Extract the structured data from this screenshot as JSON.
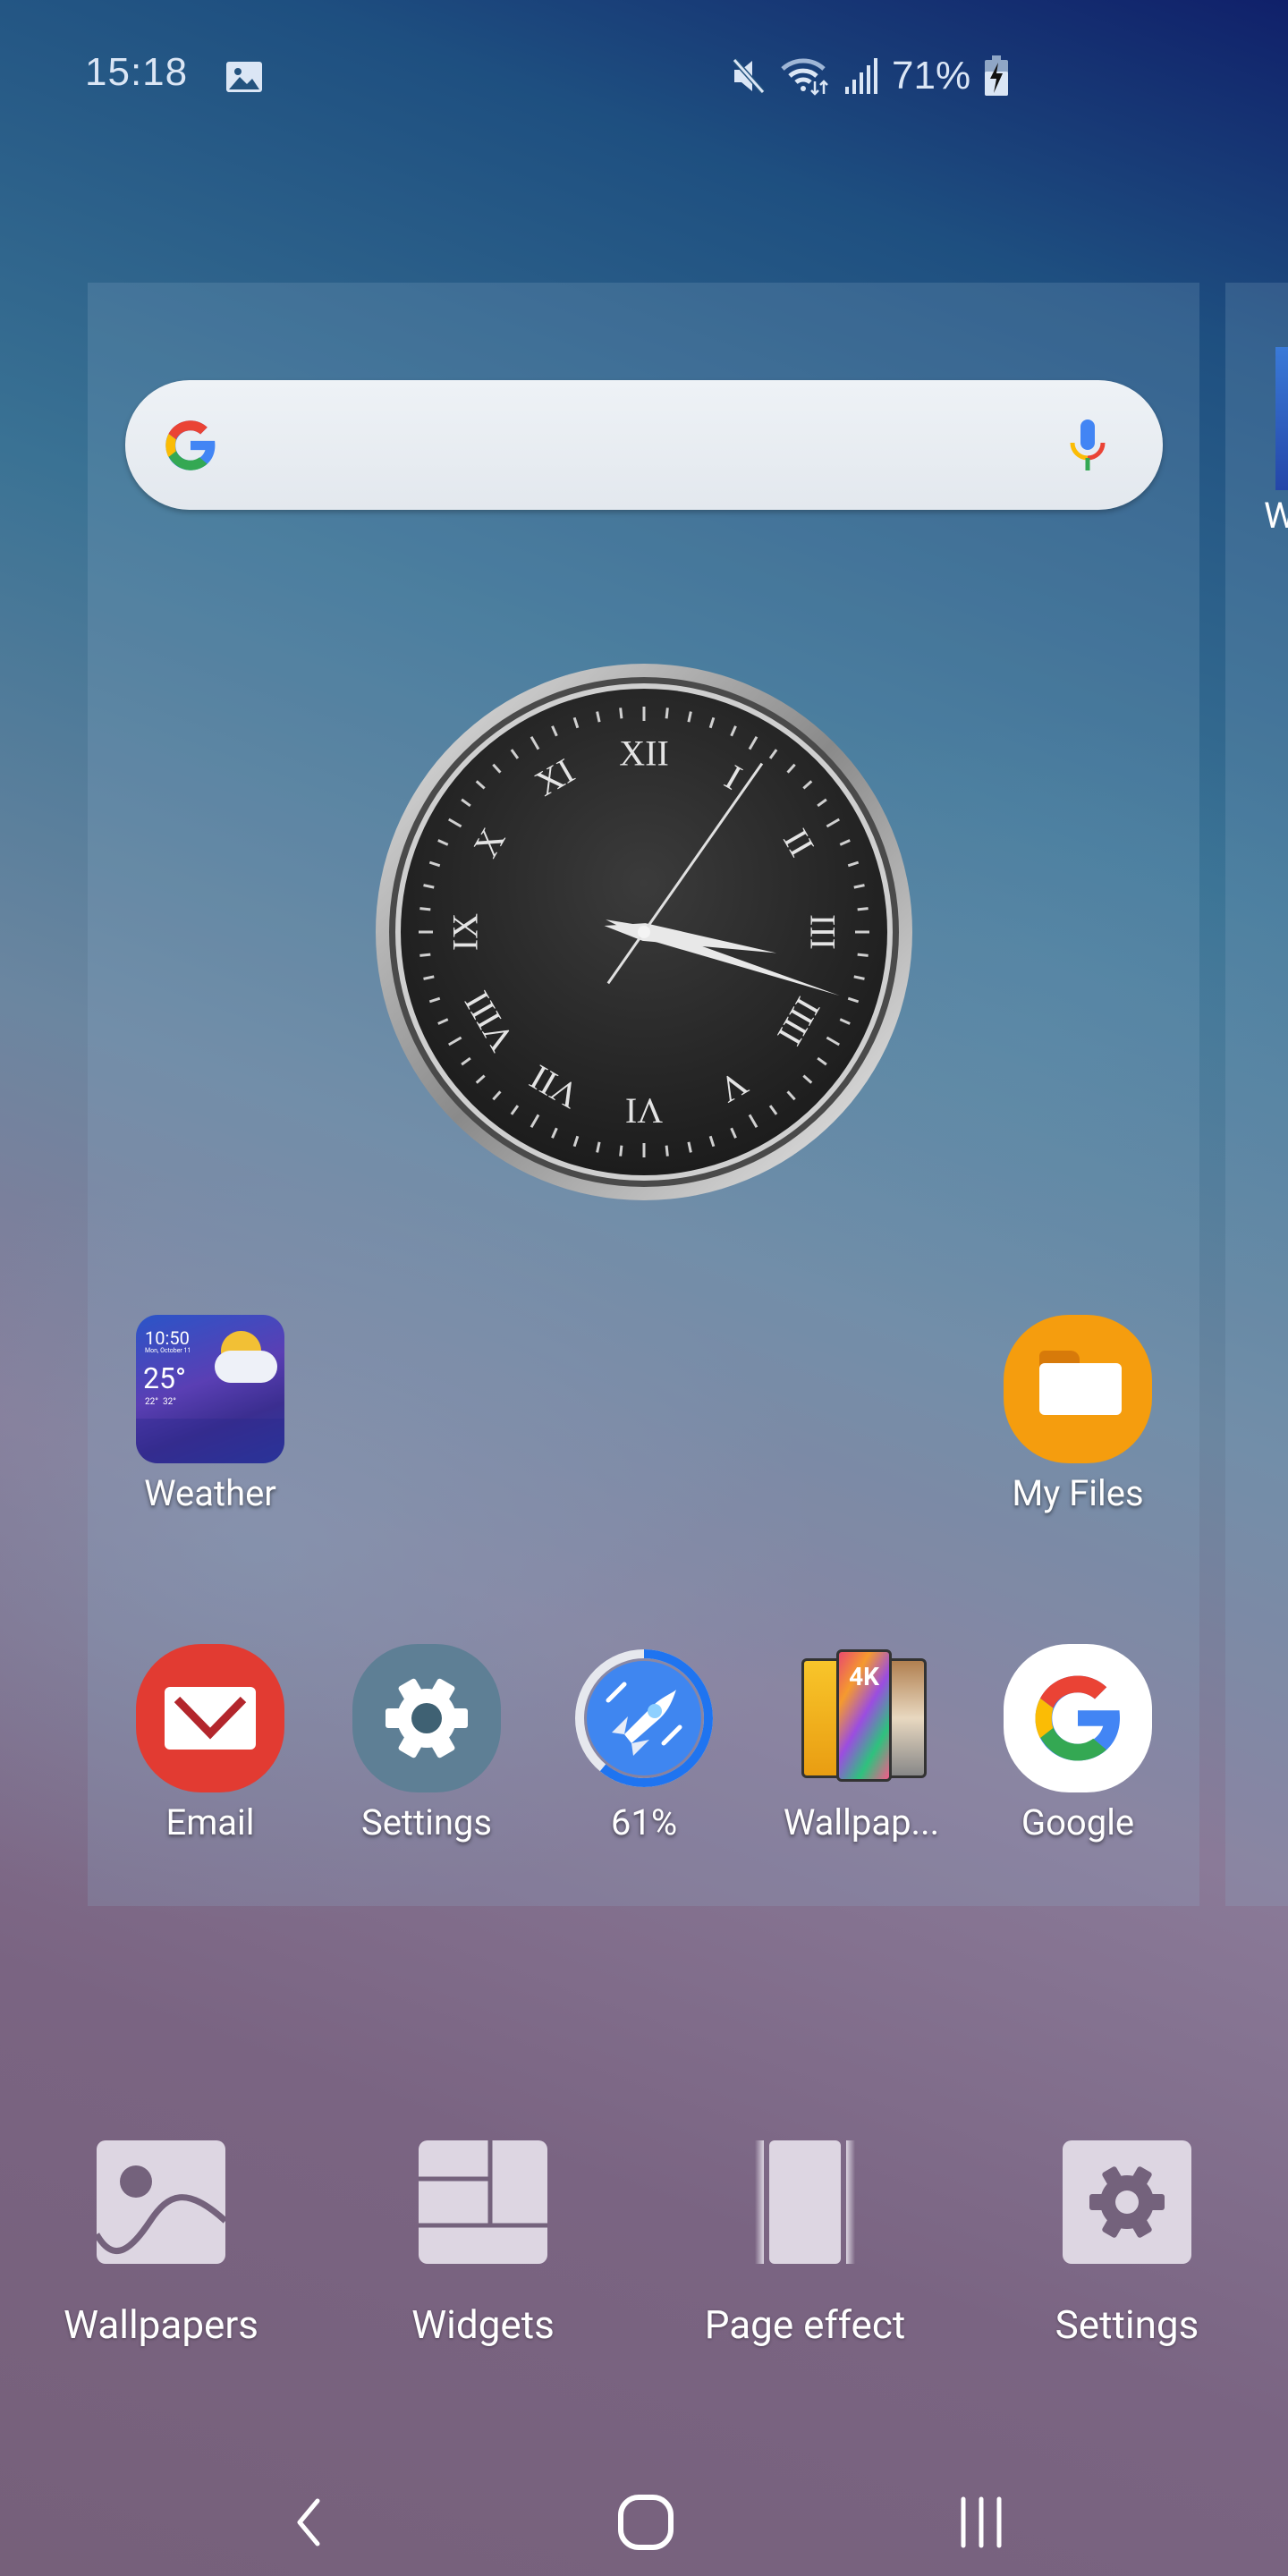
{
  "status_bar": {
    "time": "15:18",
    "notification_icons": [
      "image-icon"
    ],
    "system_icons": [
      "mute-icon",
      "wifi-icon",
      "signal-icon",
      "battery-charging-icon"
    ],
    "battery_percent": "71%"
  },
  "search_widget": {
    "logo": "google-g-icon",
    "voice_icon": "mic-icon",
    "colors": {
      "blue": "#4285F4",
      "red": "#EA4335",
      "yellow": "#FBBC05",
      "green": "#34A853"
    }
  },
  "clock_widget": {
    "type": "analog",
    "numerals": [
      "XII",
      "I",
      "II",
      "III",
      "IIII",
      "V",
      "VI",
      "VII",
      "VIII",
      "IX",
      "X",
      "XI"
    ],
    "time_shown": "15:18"
  },
  "home_apps": [
    {
      "label": "Weather",
      "icon": "weather-widget-icon",
      "preview": {
        "time": "10:50",
        "date": "Mon, October 11",
        "temp": "25°",
        "low": "22°",
        "high": "32°"
      }
    },
    {
      "label": "My Files",
      "icon": "folder-icon"
    }
  ],
  "dock_apps": [
    {
      "label": "Email",
      "icon": "email-icon"
    },
    {
      "label": "Settings",
      "icon": "gear-icon"
    },
    {
      "label": "61%",
      "icon": "rocket-booster-icon",
      "progress": 0.61
    },
    {
      "label": "Wallpap...",
      "icon": "wallpapers-4k-icon",
      "badge": "4K"
    },
    {
      "label": "Google",
      "icon": "google-icon"
    }
  ],
  "next_page": {
    "label_fragment": "W"
  },
  "edit_options": [
    {
      "label": "Wallpapers",
      "icon": "wallpaper-icon"
    },
    {
      "label": "Widgets",
      "icon": "widgets-icon"
    },
    {
      "label": "Page effect",
      "icon": "page-effect-icon"
    },
    {
      "label": "Settings",
      "icon": "settings-icon"
    }
  ],
  "nav_bar": {
    "back": "back-icon",
    "home": "home-icon",
    "recents": "recents-icon"
  }
}
